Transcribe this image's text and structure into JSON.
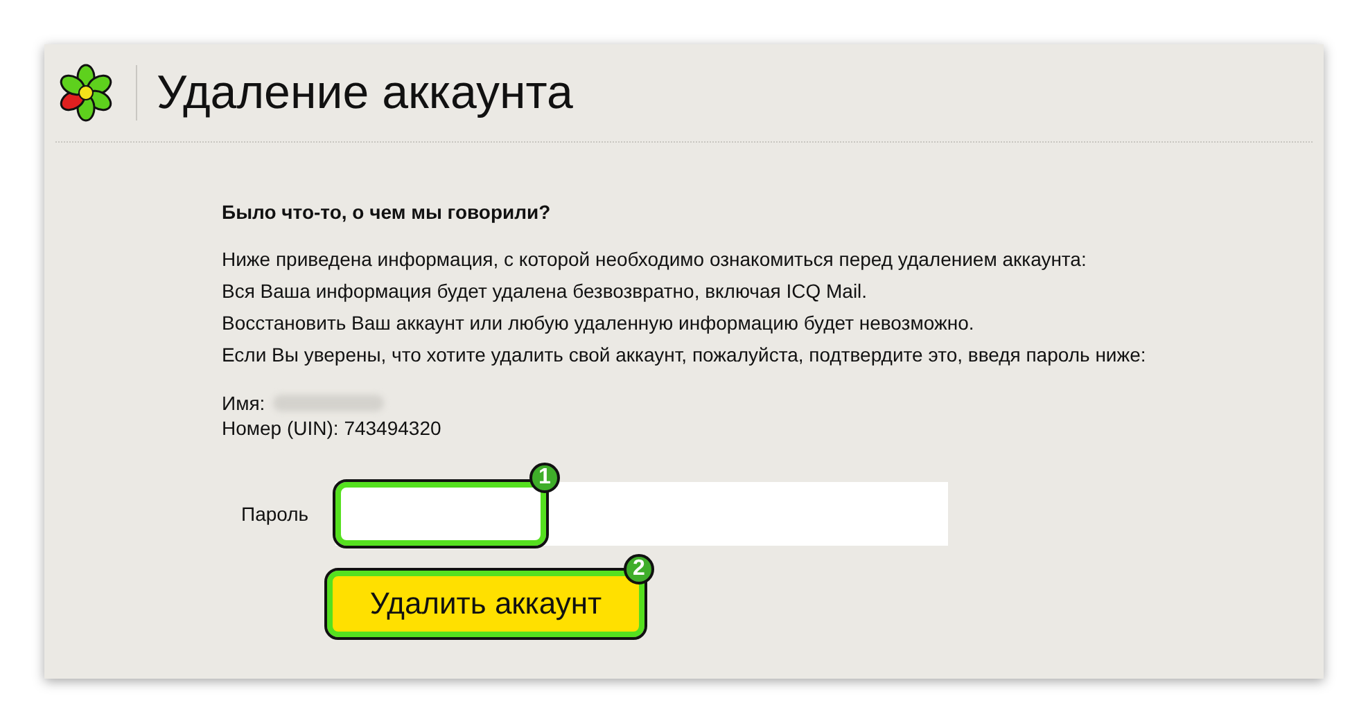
{
  "header": {
    "title": "Удаление аккаунта"
  },
  "content": {
    "heading": "Было что-то, о чем мы говорили?",
    "paragraphs": [
      "Ниже приведена информация, с которой необходимо ознакомиться перед удалением аккаунта:",
      "Вся Ваша информация будет удалена безвозвратно, включая ICQ Mail.",
      "Восстановить Ваш аккаунт или любую удаленную информацию будет невозможно.",
      "Если Вы уверены, что хотите удалить свой аккаунт, пожалуйста, подтвердите это, введя пароль ниже:"
    ],
    "name_label": "Имя:",
    "uin": "Номер (UIN): 743494320"
  },
  "form": {
    "password_label": "Пароль",
    "submit": "Удалить аккаунт"
  },
  "annotations": [
    {
      "label": "1"
    },
    {
      "label": "2"
    }
  ]
}
